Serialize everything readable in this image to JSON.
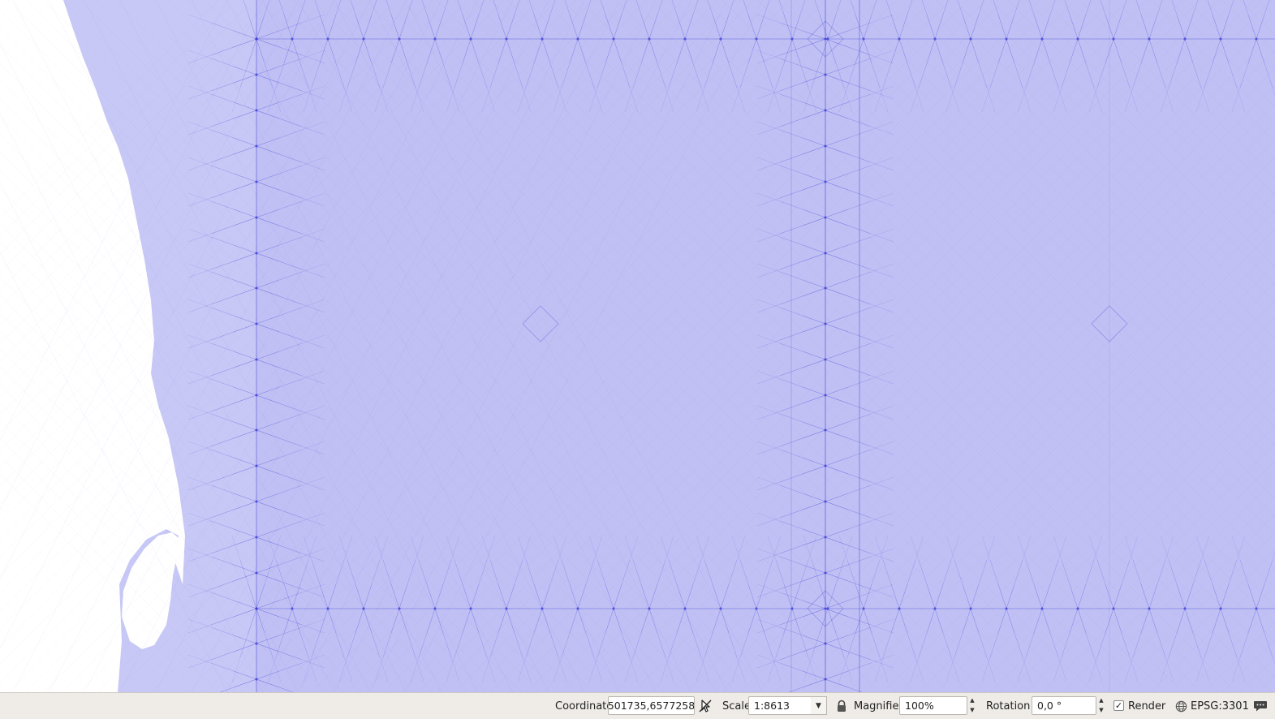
{
  "map": {
    "fill_color": "#c8c8f6",
    "line_color": "#3d3dd6",
    "background_color": "#ffffff"
  },
  "status_bar": {
    "coordinate_label": "Coordinate",
    "coordinate_value": "501735,6577258",
    "scale_label": "Scale",
    "scale_value": "1:8613",
    "magnifier_label": "Magnifier",
    "magnifier_value": "100%",
    "rotation_label": "Rotation",
    "rotation_value": "0,0 °",
    "render_label": "Render",
    "render_checked": true,
    "crs_label": "EPSG:3301",
    "icons": {
      "toggle_extents": "mouse-cursor-crossed-icon",
      "lock_scale": "lock-icon",
      "crs": "globe-icon",
      "messages": "speech-bubble-icon"
    }
  }
}
